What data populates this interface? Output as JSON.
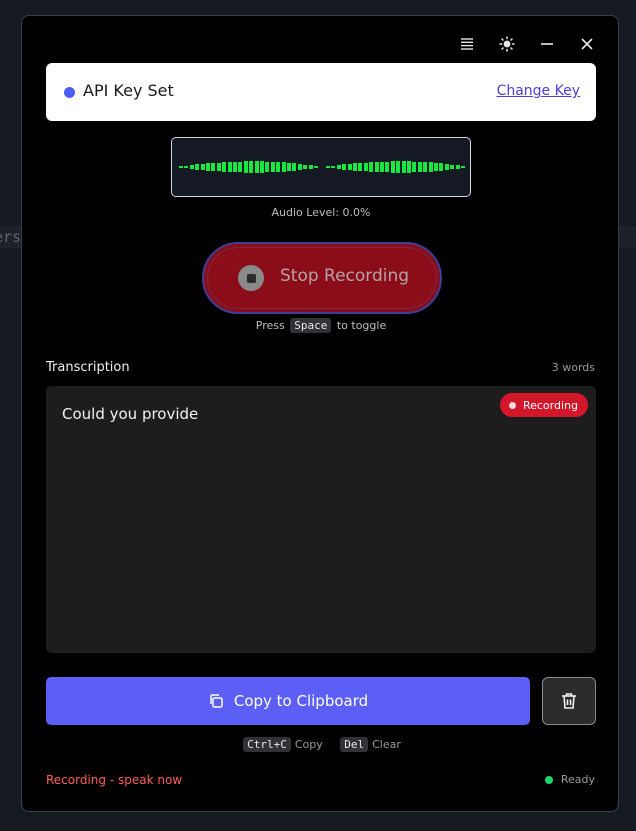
{
  "background": {
    "text": "ersion"
  },
  "window": {
    "controls": [
      {
        "name": "menu-icon"
      },
      {
        "name": "theme-toggle-icon"
      },
      {
        "name": "minimize-icon"
      },
      {
        "name": "close-icon"
      }
    ]
  },
  "api_key": {
    "status": "API Key Set",
    "change_label": "Change Key",
    "dot_color": "#4c5cf5",
    "link_color": "#4a3fd6"
  },
  "visualizer": {
    "level_label": "Audio Level: 0.0%",
    "bar_color": "#19e63f",
    "bars": [
      0.06,
      0.12,
      0.18,
      0.22,
      0.26,
      0.3,
      0.34,
      0.36,
      0.38,
      0.4,
      0.42,
      0.44,
      0.46,
      0.48,
      0.48,
      0.46,
      0.44,
      0.42,
      0.4,
      0.38,
      0.34,
      0.3,
      0.26,
      0.2,
      0.14,
      0.08,
      0.06,
      0.12,
      0.18,
      0.22,
      0.26,
      0.3,
      0.34,
      0.36,
      0.38,
      0.4,
      0.42,
      0.44,
      0.46,
      0.48,
      0.48,
      0.46,
      0.44,
      0.42,
      0.4,
      0.38,
      0.34,
      0.3,
      0.26,
      0.2,
      0.14,
      0.08
    ]
  },
  "record_button": {
    "label": "Stop Recording"
  },
  "toggle_hint": {
    "prefix": "Press",
    "key": "Space",
    "suffix": "to toggle"
  },
  "transcription": {
    "label": "Transcription",
    "word_count": "3 words",
    "text": "Could you provide",
    "badge": "Recording"
  },
  "actions": {
    "copy_label": "Copy to Clipboard",
    "accent": "#5b5ff6"
  },
  "shortcuts": [
    {
      "key": "Ctrl+C",
      "label": "Copy"
    },
    {
      "key": "Del",
      "label": "Clear"
    }
  ],
  "status": {
    "left": "Recording - speak now",
    "right": "Ready",
    "ready_color": "#19d86a"
  }
}
